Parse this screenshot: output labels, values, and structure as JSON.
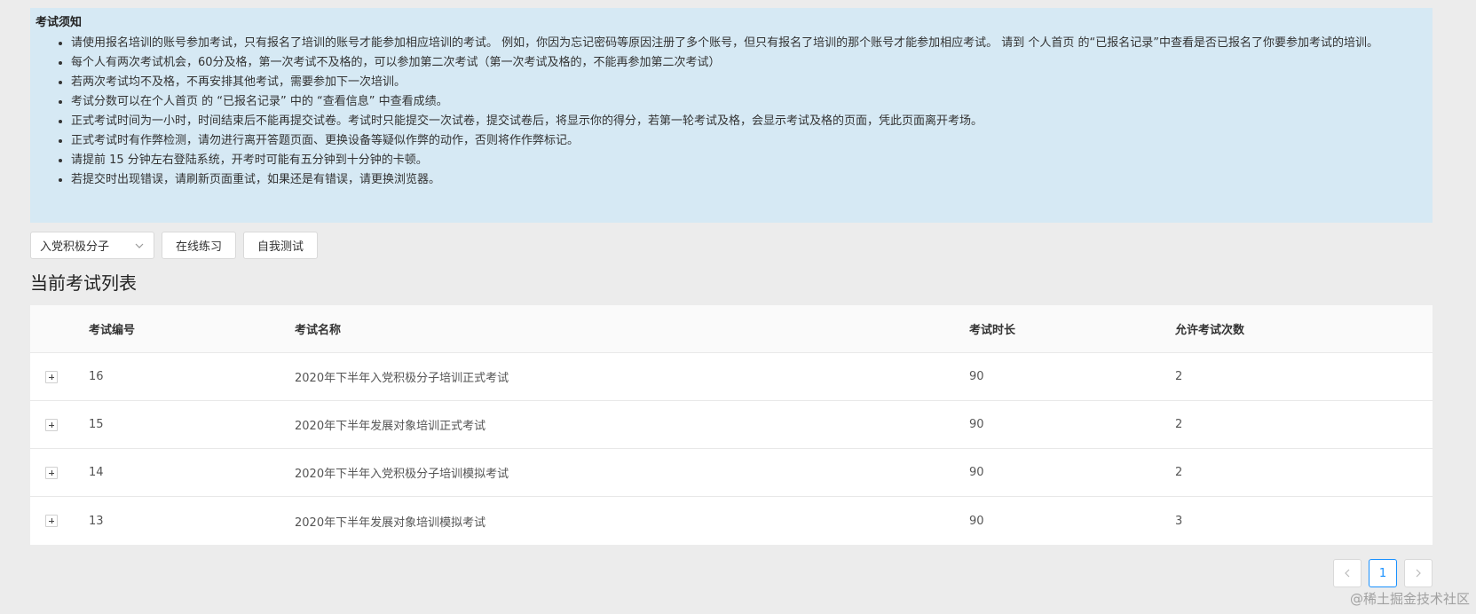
{
  "notice": {
    "title": "考试须知",
    "items": [
      "请使用报名培训的账号参加考试，只有报名了培训的账号才能参加相应培训的考试。 例如，你因为忘记密码等原因注册了多个账号，但只有报名了培训的那个账号才能参加相应考试。 请到 个人首页 的“已报名记录”中查看是否已报名了你要参加考试的培训。",
      "每个人有两次考试机会，60分及格，第一次考试不及格的，可以参加第二次考试（第一次考试及格的，不能再参加第二次考试）",
      "若两次考试均不及格，不再安排其他考试，需要参加下一次培训。",
      "考试分数可以在个人首页 的 “已报名记录” 中的 “查看信息” 中查看成绩。",
      "正式考试时间为一小时，时间结束后不能再提交试卷。考试时只能提交一次试卷，提交试卷后，将显示你的得分，若第一轮考试及格，会显示考试及格的页面，凭此页面离开考场。",
      "正式考试时有作弊检测，请勿进行离开答题页面、更换设备等疑似作弊的动作，否则将作作弊标记。",
      "请提前 15 分钟左右登陆系统，开考时可能有五分钟到十分钟的卡顿。",
      "若提交时出现错误，请刷新页面重试，如果还是有错误，请更换浏览器。"
    ]
  },
  "toolbar": {
    "select_value": "入党积极分子",
    "practice_label": "在线练习",
    "selftest_label": "自我测试"
  },
  "section_title": "当前考试列表",
  "table": {
    "headers": {
      "id": "考试编号",
      "name": "考试名称",
      "duration": "考试时长",
      "times": "允许考试次数"
    },
    "rows": [
      {
        "id": "16",
        "name": "2020年下半年入党积极分子培训正式考试",
        "duration": "90",
        "times": "2"
      },
      {
        "id": "15",
        "name": "2020年下半年发展对象培训正式考试",
        "duration": "90",
        "times": "2"
      },
      {
        "id": "14",
        "name": "2020年下半年入党积极分子培训模拟考试",
        "duration": "90",
        "times": "2"
      },
      {
        "id": "13",
        "name": "2020年下半年发展对象培训模拟考试",
        "duration": "90",
        "times": "3"
      }
    ]
  },
  "pagination": {
    "current_page": "1",
    "prev_icon": "chevron-left-icon",
    "next_icon": "chevron-right-icon",
    "active_color": "#1890ff"
  },
  "watermark": "@稀土掘金技术社区"
}
